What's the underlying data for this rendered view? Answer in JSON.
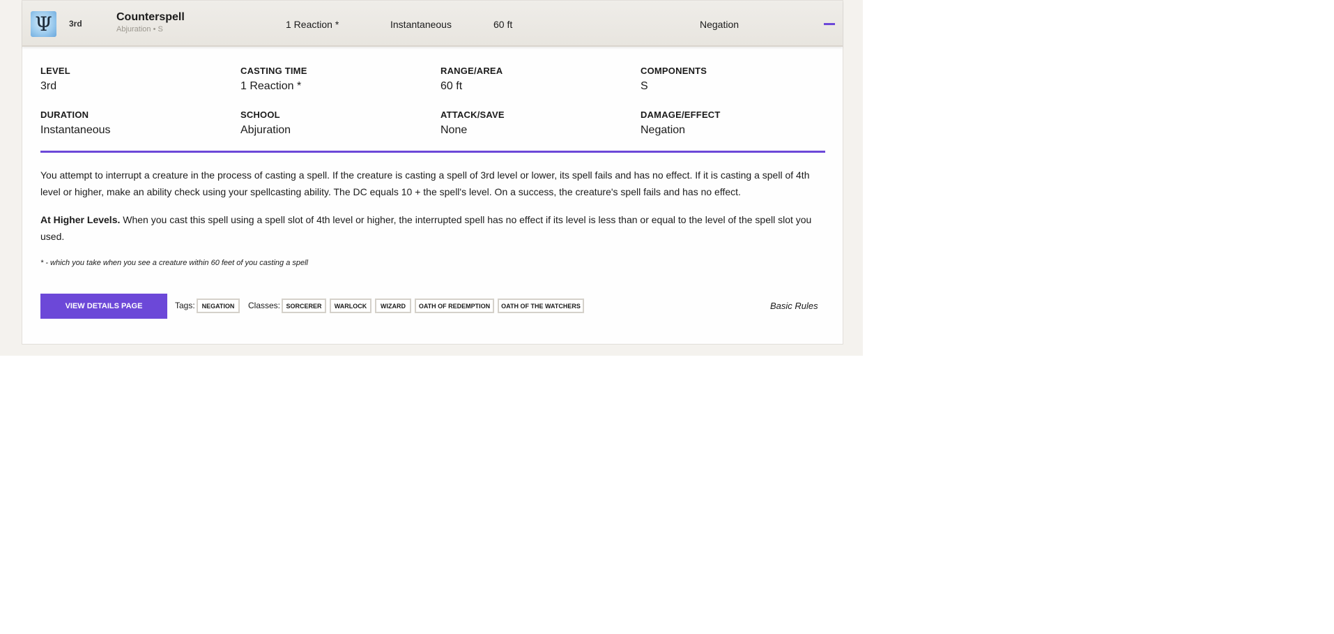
{
  "header": {
    "icon": "school-trident-icon",
    "level": "3rd",
    "name": "Counterspell",
    "subtitle": "Abjuration • S",
    "casting_time": "1 Reaction *",
    "duration": "Instantaneous",
    "range": "60 ft",
    "effect": "Negation",
    "collapse_icon": "minus-icon"
  },
  "stats": {
    "level": {
      "label": "LEVEL",
      "value": "3rd"
    },
    "casting_time": {
      "label": "CASTING TIME",
      "value": "1 Reaction *"
    },
    "range": {
      "label": "RANGE/AREA",
      "value": "60 ft"
    },
    "components": {
      "label": "COMPONENTS",
      "value": "S"
    },
    "duration": {
      "label": "DURATION",
      "value": "Instantaneous"
    },
    "school": {
      "label": "SCHOOL",
      "value": "Abjuration"
    },
    "attack_save": {
      "label": "ATTACK/SAVE",
      "value": "None"
    },
    "damage_effect": {
      "label": "DAMAGE/EFFECT",
      "value": "Negation"
    }
  },
  "description": {
    "main": "You attempt to interrupt a creature in the process of casting a spell. If the creature is casting a spell of 3rd level or lower, its spell fails and has no effect. If it is casting a spell of 4th level or higher, make an ability check using your spellcasting ability. The DC equals 10 + the spell's level. On a success, the creature's spell fails and has no effect.",
    "higher_label": "At Higher Levels.",
    "higher_text": " When you cast this spell using a spell slot of 4th level or higher, the interrupted spell has no effect if its level is less than or equal to the level of the spell slot you used.",
    "footnote": "* - which you take when you see a creature within 60 feet of you casting a spell"
  },
  "footer": {
    "details_button": "VIEW DETAILS PAGE",
    "tags_label": "Tags:",
    "tags": [
      "NEGATION"
    ],
    "classes_label": "Classes:",
    "classes": [
      "SORCERER",
      "WARLOCK",
      "WIZARD",
      "OATH OF REDEMPTION",
      "OATH OF THE WATCHERS"
    ],
    "source": "Basic Rules"
  },
  "colors": {
    "accent": "#6c48d8",
    "parchment": "#f4f2ee",
    "header_bg": "#ece9e4"
  }
}
